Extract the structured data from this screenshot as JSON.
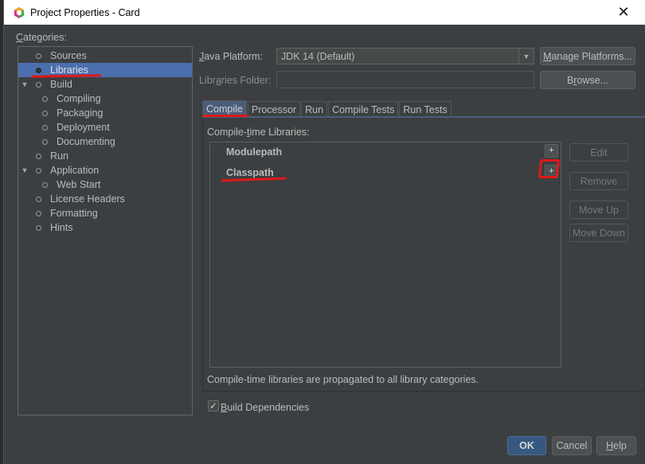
{
  "window": {
    "title": "Project Properties - Card",
    "close_glyph": "✕",
    "app_icon": "netbeans-cube-icon"
  },
  "categories": {
    "label_underlined": "C",
    "label_rest": "ategories:",
    "items": [
      {
        "label": "Sources",
        "level": 0,
        "expandable": false,
        "selected": false
      },
      {
        "label": "Libraries",
        "level": 0,
        "expandable": false,
        "selected": true
      },
      {
        "label": "Build",
        "level": 0,
        "expandable": true,
        "expanded": true,
        "selected": false
      },
      {
        "label": "Compiling",
        "level": 1,
        "expandable": false,
        "selected": false
      },
      {
        "label": "Packaging",
        "level": 1,
        "expandable": false,
        "selected": false
      },
      {
        "label": "Deployment",
        "level": 1,
        "expandable": false,
        "selected": false
      },
      {
        "label": "Documenting",
        "level": 1,
        "expandable": false,
        "selected": false
      },
      {
        "label": "Run",
        "level": 0,
        "expandable": false,
        "selected": false
      },
      {
        "label": "Application",
        "level": 0,
        "expandable": true,
        "expanded": true,
        "selected": false
      },
      {
        "label": "Web Start",
        "level": 1,
        "expandable": false,
        "selected": false
      },
      {
        "label": "License Headers",
        "level": 0,
        "expandable": false,
        "selected": false
      },
      {
        "label": "Formatting",
        "level": 0,
        "expandable": false,
        "selected": false
      },
      {
        "label": "Hints",
        "level": 0,
        "expandable": false,
        "selected": false
      }
    ]
  },
  "platform": {
    "label_underlined": "J",
    "label_rest": "ava Platform:",
    "value": "JDK 14 (Default)",
    "dropdown_glyph": "▼",
    "manage_underlined": "M",
    "manage_rest": "anage Platforms..."
  },
  "libraries_folder": {
    "label_pre": "Libr",
    "label_underlined": "a",
    "label_post": "ries Folder:",
    "value": "",
    "browse_pre": "B",
    "browse_underlined": "r",
    "browse_post": "owse..."
  },
  "tabs": [
    {
      "label": "Compile",
      "active": true
    },
    {
      "label": "Processor",
      "active": false
    },
    {
      "label": "Run",
      "active": false
    },
    {
      "label": "Compile Tests",
      "active": false
    },
    {
      "label": "Run Tests",
      "active": false
    }
  ],
  "compile": {
    "list_label_pre": "Compile-",
    "list_label_underlined": "t",
    "list_label_post": "ime Libraries:",
    "entries": [
      {
        "label": "Modulepath",
        "add_glyph": "+"
      },
      {
        "label": "Classpath",
        "add_glyph": "+"
      }
    ],
    "buttons": {
      "edit": "Edit",
      "remove": "Remove",
      "move_up": "Move Up",
      "move_down": "Move Down"
    },
    "note": "Compile-time libraries are propagated to all library categories."
  },
  "build_dependencies": {
    "checked": true,
    "check_glyph": "✓",
    "label_underlined": "B",
    "label_rest": "uild Dependencies"
  },
  "footer": {
    "ok": "OK",
    "cancel": "Cancel",
    "help_underlined": "H",
    "help_rest": "elp"
  },
  "colors": {
    "selection": "#4b6eaf",
    "annotation": "#e01818",
    "ok_button": "#365880"
  }
}
